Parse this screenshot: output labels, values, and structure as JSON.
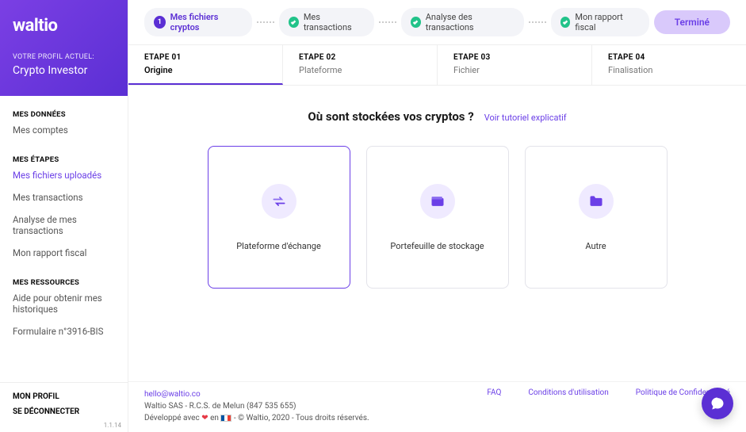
{
  "brand": "waltio",
  "profile": {
    "label": "VOTRE PROFIL ACTUEL:",
    "name": "Crypto Investor"
  },
  "side": {
    "h1": "MES DONNÉES",
    "i1": "Mes comptes",
    "h2": "MES ÉTAPES",
    "i2": "Mes fichiers uploadés",
    "i3": "Mes transactions",
    "i4": "Analyse de mes transactions",
    "i5": "Mon rapport fiscal",
    "h3": "MES RESSOURCES",
    "i6": "Aide pour obtenir mes historiques",
    "i7": "Formulaire n°3916-BIS",
    "b1": "MON PROFIL",
    "b2": "SE DÉCONNECTER",
    "ver": "1.1.14"
  },
  "wizard": {
    "s1": {
      "n": "1",
      "l": "Mes fichiers cryptos"
    },
    "s2": "Mes transactions",
    "s3": "Analyse des transactions",
    "s4": "Mon rapport fiscal",
    "done": "Terminé"
  },
  "etapes": {
    "e1": {
      "n": "ETAPE 01",
      "s": "Origine"
    },
    "e2": {
      "n": "ETAPE 02",
      "s": "Plateforme"
    },
    "e3": {
      "n": "ETAPE 03",
      "s": "Fichier"
    },
    "e4": {
      "n": "ETAPE 04",
      "s": "Finalisation"
    }
  },
  "content": {
    "q": "Où sont stockées vos cryptos ?",
    "tut": "Voir tutoriel explicatif",
    "c1": "Plateforme d'échange",
    "c2": "Portefeuille de stockage",
    "c3": "Autre"
  },
  "footer": {
    "email": "hello@waltio.co",
    "line2": "Waltio SAS - R.C.S. de Melun (847 535 655)",
    "dev1": "Développé avec ",
    "dev2": " en ",
    "dev3": " - © Waltio, 2020 - Tous droits réservés.",
    "faq": "FAQ",
    "terms": "Conditions d'utilisation",
    "privacy": "Politique de Confidentialité"
  }
}
